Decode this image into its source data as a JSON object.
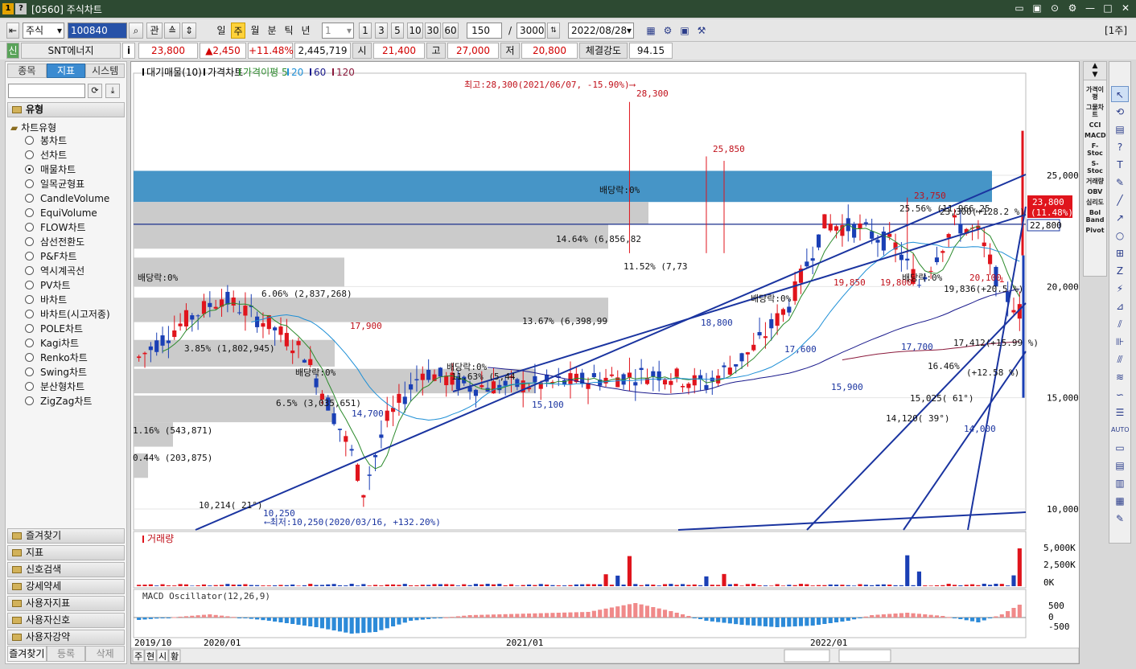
{
  "window": {
    "title": "[0560] 주식차트",
    "badge1": "1",
    "badge2": "?",
    "controls": [
      "▭",
      "▣",
      "⊙",
      "⚙",
      "—",
      "□",
      "✕"
    ]
  },
  "toolbar": {
    "market": "주식",
    "code": "100840",
    "gwan": "관",
    "periods": [
      "일",
      "주",
      "월",
      "분",
      "틱",
      "년"
    ],
    "selected_period": "주",
    "interval": "1",
    "quick": [
      "1",
      "3",
      "5",
      "10",
      "30",
      "60"
    ],
    "count": "150",
    "slash": "/",
    "total": "3000",
    "date": "2022/08/28",
    "right_tag": "[1주]"
  },
  "inforow": {
    "sin": "신",
    "name": "SNT에너지",
    "info": "i",
    "price": "23,800",
    "change": "▲2,450",
    "rate": "+11.48%",
    "volume": "2,445,719",
    "open_label": "시",
    "open": "21,400",
    "high_label": "고",
    "high": "27,000",
    "low_label": "저",
    "low": "20,800",
    "strength_label": "체결강도",
    "strength": "94.15"
  },
  "leftpanel": {
    "tabs": [
      "종목",
      "지표",
      "시스템"
    ],
    "active_tab": "지표",
    "group_type": "유형",
    "tree_root": "차트유형",
    "chart_types": [
      "봉차트",
      "선차트",
      "매물차트",
      "일목균형표",
      "CandleVolume",
      "EquiVolume",
      "FLOW차트",
      "삼선전환도",
      "P&F차트",
      "역시계곡선",
      "PV차트",
      "바차트",
      "바차트(시고저종)",
      "POLE차트",
      "Kagi차트",
      "Renko차트",
      "Swing차트",
      "분산형차트",
      "ZigZag차트"
    ],
    "selected_type": "매물차트",
    "groups": [
      "즐겨찾기",
      "지표",
      "신호검색",
      "강세약세",
      "사용자지표",
      "사용자신호",
      "사용자강약"
    ],
    "bottom": [
      "즐겨찾기",
      "등록",
      "삭제"
    ]
  },
  "chart": {
    "legend_main": [
      "대기매물(10)",
      "가격차트",
      "가격이평 5",
      "20",
      "60",
      "120"
    ],
    "legend_colors": [
      "#000000",
      "#000000",
      "#2b8a2b",
      "#1e8fd6",
      "#1a1a8c",
      "#8b1a3c"
    ],
    "y_labels": [
      "25,000",
      "20,000",
      "15,000",
      "10,000"
    ],
    "current_price_tag": "23,800",
    "current_rate_tag": "(11.48%)",
    "crosshair_tag": "22,800",
    "max_note": "최고:28,300(2021/06/07, -15.90%)⟶",
    "min_note": "⟵최저:10,250(2020/03/16, +132.20%)",
    "price_labels": [
      "28,300",
      "25,850",
      "23,750",
      "17,900",
      "19,850",
      "19,800",
      "20,100",
      "18,800",
      "17,600",
      "17,700",
      "15,900",
      "14,700",
      "15,100",
      "14,000",
      "10,250"
    ],
    "dividend_label": "배당락:0%",
    "volume_profile_labels": [
      "14.64% (6,856,82",
      "11.52% (7,73",
      "6.06% (2,837,268)",
      "13.67% (6,398,99",
      "3.85% (1,802,945)",
      "11.63% (5,44",
      "6.5% (3,035,651)",
      "1.16% (543,871)",
      "0.44% (203,875)",
      "25.56% (11,966,25",
      "16.46%"
    ],
    "trend_labels": [
      "10,214( 21°)",
      "14,120( 39°)",
      "15,025( 61°)",
      "19,836(+20.5 %)",
      "23,300(+128.2 %)",
      "17,412(+15.99 %)",
      "(+12.58 %)"
    ],
    "x_labels": [
      "2019/10",
      "2020/01",
      "2021/01",
      "2022/01"
    ],
    "volume_legend": "거래량",
    "volume_axis": [
      "5,000K",
      "2,500K",
      "0K"
    ],
    "macd_legend": "MACD Oscillator(12,26,9)",
    "macd_axis": [
      "500",
      "0",
      "-500"
    ],
    "bottom_tabs": [
      "주",
      "현",
      "시",
      "황"
    ]
  },
  "ytool": [
    "가격이평",
    "그물차트",
    "CCI",
    "MACD",
    "F-Stoc",
    "S-Stoc",
    "거래량",
    "OBV",
    "심리도",
    "Bol Band",
    "Pivot"
  ],
  "drawtool": [
    "↖",
    "⟲",
    "▤",
    "?",
    "T",
    "✎",
    "╱",
    "↗",
    "○",
    "⊞",
    "Z",
    "⚡",
    "⊿",
    "⫽",
    "⊪",
    "⫻",
    "≋",
    "∽",
    "☰",
    "AUTO",
    "▭",
    "▤",
    "▥",
    "▦",
    "✎"
  ]
}
